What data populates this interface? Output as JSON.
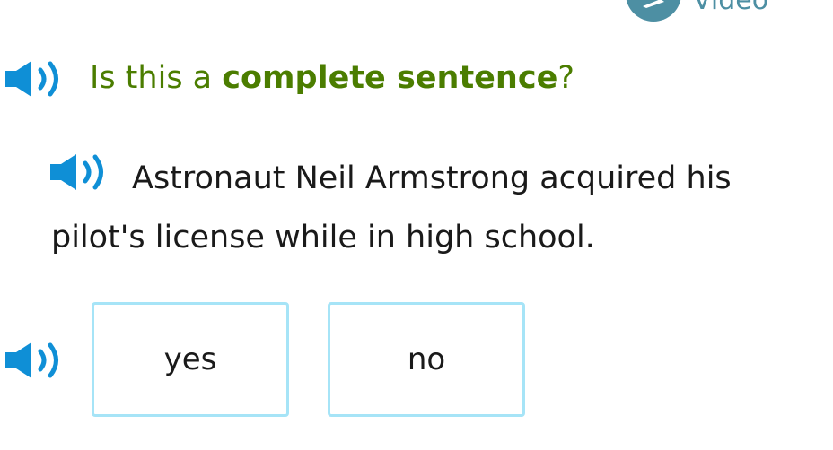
{
  "header": {
    "video_label": "Video",
    "video_icon": "pencil-icon"
  },
  "question": {
    "prefix": "Is this a ",
    "emphasis": "complete sentence",
    "suffix": "?",
    "audio_icon": "speaker-icon"
  },
  "sentence": {
    "text": "Astronaut Neil Armstrong acquired his pilot's license while in high school.",
    "audio_icon": "speaker-icon"
  },
  "choices": {
    "audio_icon": "speaker-icon",
    "options": [
      {
        "label": "yes"
      },
      {
        "label": "no"
      }
    ]
  },
  "colors": {
    "question_text": "#4b7d00",
    "speaker": "#0f8fd6",
    "choice_border": "#a6e4f7",
    "video_badge": "#4d8fa3"
  }
}
